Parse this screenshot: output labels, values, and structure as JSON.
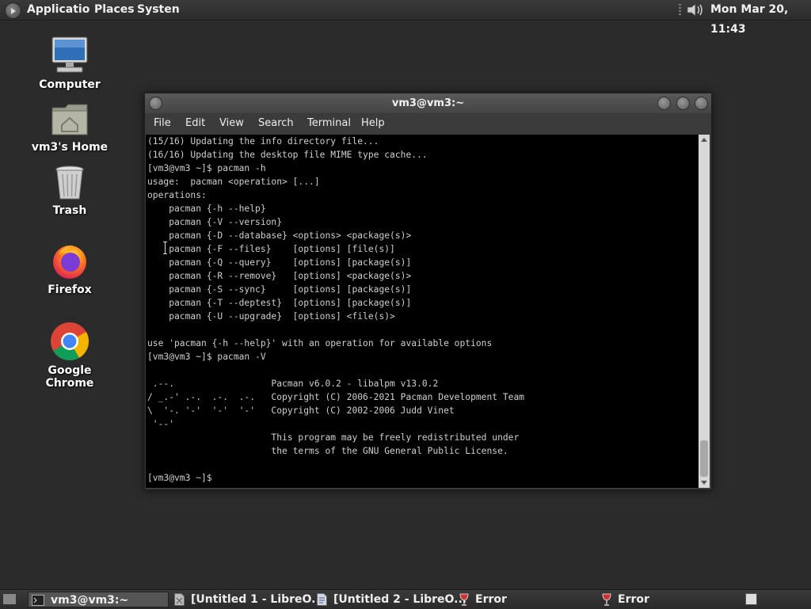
{
  "top_panel": {
    "menu": [
      "Applicatio",
      "Places",
      "Systen"
    ],
    "clock": "Mon Mar 20, 11:43"
  },
  "desktop_icons": [
    {
      "label": "Computer",
      "icon": "computer-icon"
    },
    {
      "label": "vm3's Home",
      "icon": "home-folder-icon"
    },
    {
      "label": "Trash",
      "icon": "trash-icon"
    },
    {
      "label": "Firefox",
      "icon": "firefox-icon"
    },
    {
      "label": "Google Chrome",
      "icon": "chrome-icon"
    }
  ],
  "terminal": {
    "title": "vm3@vm3:~",
    "menu": [
      "File",
      "Edit",
      "View",
      "Search",
      "Terminal",
      "Help"
    ],
    "lines": [
      "(15/16) Updating the info directory file...",
      "(16/16) Updating the desktop file MIME type cache...",
      "[vm3@vm3 ~]$ pacman -h",
      "usage:  pacman <operation> [...]",
      "operations:",
      "    pacman {-h --help}",
      "    pacman {-V --version}",
      "    pacman {-D --database} <options> <package(s)>",
      "    pacman {-F --files}    [options] [file(s)]",
      "    pacman {-Q --query}    [options] [package(s)]",
      "    pacman {-R --remove}   [options] <package(s)>",
      "    pacman {-S --sync}     [options] [package(s)]",
      "    pacman {-T --deptest}  [options] [package(s)]",
      "    pacman {-U --upgrade}  [options] <file(s)>",
      "",
      "use 'pacman {-h --help}' with an operation for available options",
      "[vm3@vm3 ~]$ pacman -V",
      "",
      " .--.                  Pacman v6.0.2 - libalpm v13.0.2",
      "/ _.-' .-.  .-.  .-.   Copyright (C) 2006-2021 Pacman Development Team",
      "\\  '-. '-'  '-'  '-'   Copyright (C) 2002-2006 Judd Vinet",
      " '--'",
      "                       This program may be freely redistributed under",
      "                       the terms of the GNU General Public License.",
      "",
      "[vm3@vm3 ~]$ "
    ]
  },
  "taskbar": {
    "tasks": [
      {
        "label": "vm3@vm3:~",
        "icon": "terminal-icon",
        "active": true
      },
      {
        "label": "[Untitled 1 - LibreO...",
        "icon": "document-icon",
        "active": false
      },
      {
        "label": "[Untitled 2 - LibreO...",
        "icon": "document-icon",
        "active": false
      },
      {
        "label": "Error",
        "icon": "error-glass-icon",
        "active": false
      },
      {
        "label": "Error",
        "icon": "error-glass-icon",
        "active": false
      }
    ]
  }
}
